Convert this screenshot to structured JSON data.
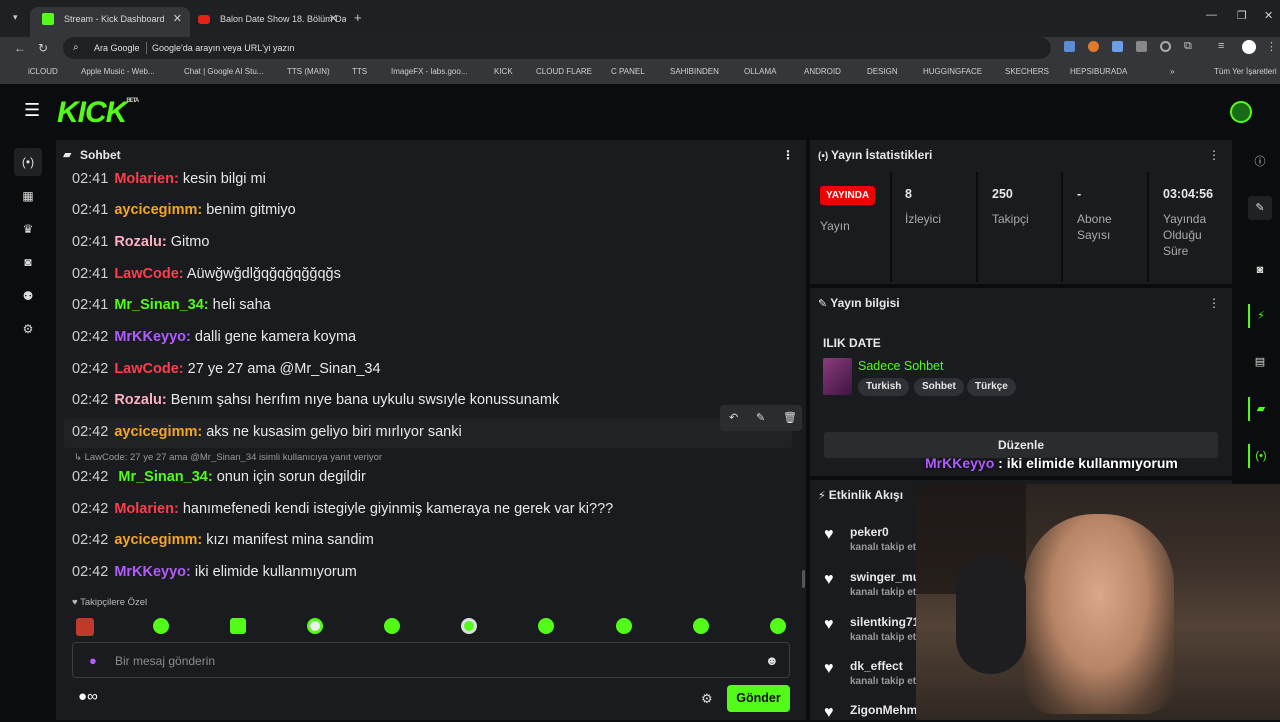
{
  "browser": {
    "tabs": [
      {
        "label": "Stream - Kick Dashboard"
      },
      {
        "label": "Balon Date Show 18. Bölüm Da"
      }
    ],
    "omnibox": {
      "search_engine": "Ara Google",
      "placeholder": "Google'da arayın veya URL'yi yazın"
    },
    "bookmarks": [
      "iCLOUD",
      "Apple Music - Web...",
      "Chat | Google AI Stu...",
      "TTS (MAIN)",
      "TTS",
      "ImageFX - labs.goo...",
      "KICK",
      "CLOUD FLARE",
      "C PANEL",
      "SAHIBINDEN",
      "OLLAMA",
      "ANDROID",
      "DESIGN",
      "HUGGINGFACE",
      "SKECHERS",
      "HEPSIBURADA"
    ],
    "all_bookmarks": "Tüm Yer İşaretleri"
  },
  "kick": {
    "logo": "KICK",
    "beta": "BETA"
  },
  "chat": {
    "title": "Sohbet",
    "messages": [
      {
        "time": "02:41",
        "user": "Molarien",
        "color": "#ff3d4d",
        "text": "kesin bilgi mi"
      },
      {
        "time": "02:41",
        "user": "aycicegimm",
        "color": "#f5a623",
        "text": "benim gitmiyo"
      },
      {
        "time": "02:41",
        "user": "Rozalu",
        "color": "#ffb0c0",
        "text": "Gitmo"
      },
      {
        "time": "02:41",
        "user": "LawCode",
        "color": "#ff3d4d",
        "text": "Aüwğwğdlğqğqğqğğqğs"
      },
      {
        "time": "02:41",
        "user": "Mr_Sinan_34",
        "color": "#53fc18",
        "text": "heli saha"
      },
      {
        "time": "02:42",
        "user": "MrKKeyyo",
        "color": "#b05cff",
        "text": "dalli gene kamera koyma"
      },
      {
        "time": "02:42",
        "user": "LawCode",
        "color": "#ff3d4d",
        "text": "27 ye 27 ama @Mr_Sinan_34"
      },
      {
        "time": "02:42",
        "user": "Rozalu",
        "color": "#ffb0c0",
        "text": "Benım şahsı herıfım nıye bana uykulu swsıyle konussunamk"
      },
      {
        "time": "02:42",
        "user": "aycicegimm",
        "color": "#f5a623",
        "text": "aks ne kusasim geliyo biri mırlıyor sanki"
      },
      {
        "time": "02:42",
        "user": "Mr_Sinan_34",
        "color": "#53fc18",
        "text": "onun için sorun degildir"
      },
      {
        "time": "02:42",
        "user": "Molarien",
        "color": "#ff3d4d",
        "text": "hanımefenedi kendi istegiyle giyinmiş kameraya ne gerek var ki???"
      },
      {
        "time": "02:42",
        "user": "aycicegimm",
        "color": "#f5a623",
        "text": "kızı manifest mina sandim"
      },
      {
        "time": "02:42",
        "user": "MrKKeyyo",
        "color": "#b05cff",
        "text": "iki elimide kullanmıyorum"
      }
    ],
    "reply_note": "LawCode: 27 ye 27 ama @Mr_Sinan_34 isimli kullanıcıya yanıt veriyor",
    "followers_only": "Takipçilere Özel",
    "input_placeholder": "Bir mesaj gönderin",
    "send_label": "Gönder",
    "infinity": "∞"
  },
  "stats": {
    "title": "Yayın İstatistikleri",
    "live_badge": "YAYINDA",
    "live_label": "Yayın",
    "viewers": {
      "value": "8",
      "label": "İzleyici"
    },
    "followers": {
      "value": "250",
      "label": "Takipçi"
    },
    "subs": {
      "value": "-",
      "label": "Abone Sayısı"
    },
    "duration": {
      "value": "03:04:56",
      "label": "Yayında Olduğu Süre"
    }
  },
  "stream_info": {
    "title": "Yayın bilgisi",
    "stream_title": "ILIK DATE",
    "category": "Sadece Sohbet",
    "tags": [
      "Turkish",
      "Sohbet",
      "Türkçe"
    ],
    "edit_label": "Düzenle"
  },
  "activity": {
    "title": "Etkinlik Akışı",
    "events": [
      {
        "user": "peker0",
        "text": "kanalı takip et"
      },
      {
        "user": "swinger_mu",
        "text": "kanalı takip et"
      },
      {
        "user": "silentking71",
        "text": "kanalı takip et"
      },
      {
        "user": "dk_effect",
        "text": "kanalı takip et"
      },
      {
        "user": "ZigonMehm",
        "text": ""
      }
    ]
  },
  "overlay": {
    "user": "MrKKeyyo",
    "text": ": iki elimide kullanmıyorum"
  },
  "colors": {
    "accent": "#53fc18",
    "live": "#eb0400",
    "panel": "#191b1f"
  }
}
